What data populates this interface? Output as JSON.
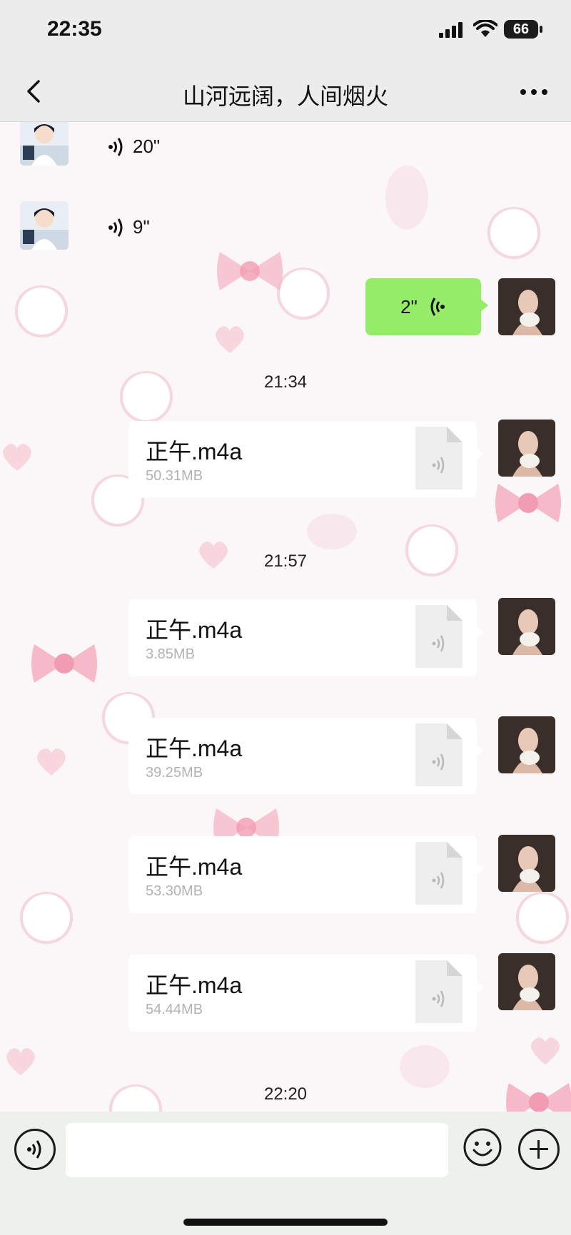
{
  "status_bar": {
    "time": "22:35",
    "battery": "66"
  },
  "nav": {
    "title": "山河远阔，人间烟火"
  },
  "messages": {
    "voice_in_1": {
      "duration": "20\""
    },
    "voice_in_2": {
      "duration": "9\""
    },
    "voice_out_1": {
      "duration": "2\""
    },
    "timestamps": [
      "21:34",
      "21:57",
      "22:20"
    ],
    "files": [
      {
        "name": "正午.m4a",
        "size": "50.31MB"
      },
      {
        "name": "正午.m4a",
        "size": "3.85MB"
      },
      {
        "name": "正午.m4a",
        "size": "39.25MB"
      },
      {
        "name": "正午.m4a",
        "size": "53.30MB"
      },
      {
        "name": "正午.m4a",
        "size": "54.44MB"
      }
    ]
  },
  "colors": {
    "sent_bubble": "#95ec69",
    "bar_bg": "#eef0ee",
    "accent_pink": "#f3b8c8"
  },
  "icons": [
    "back-arrow-icon",
    "more-icon",
    "voice-icon",
    "audio-file-icon",
    "emoji-icon",
    "plus-icon"
  ]
}
